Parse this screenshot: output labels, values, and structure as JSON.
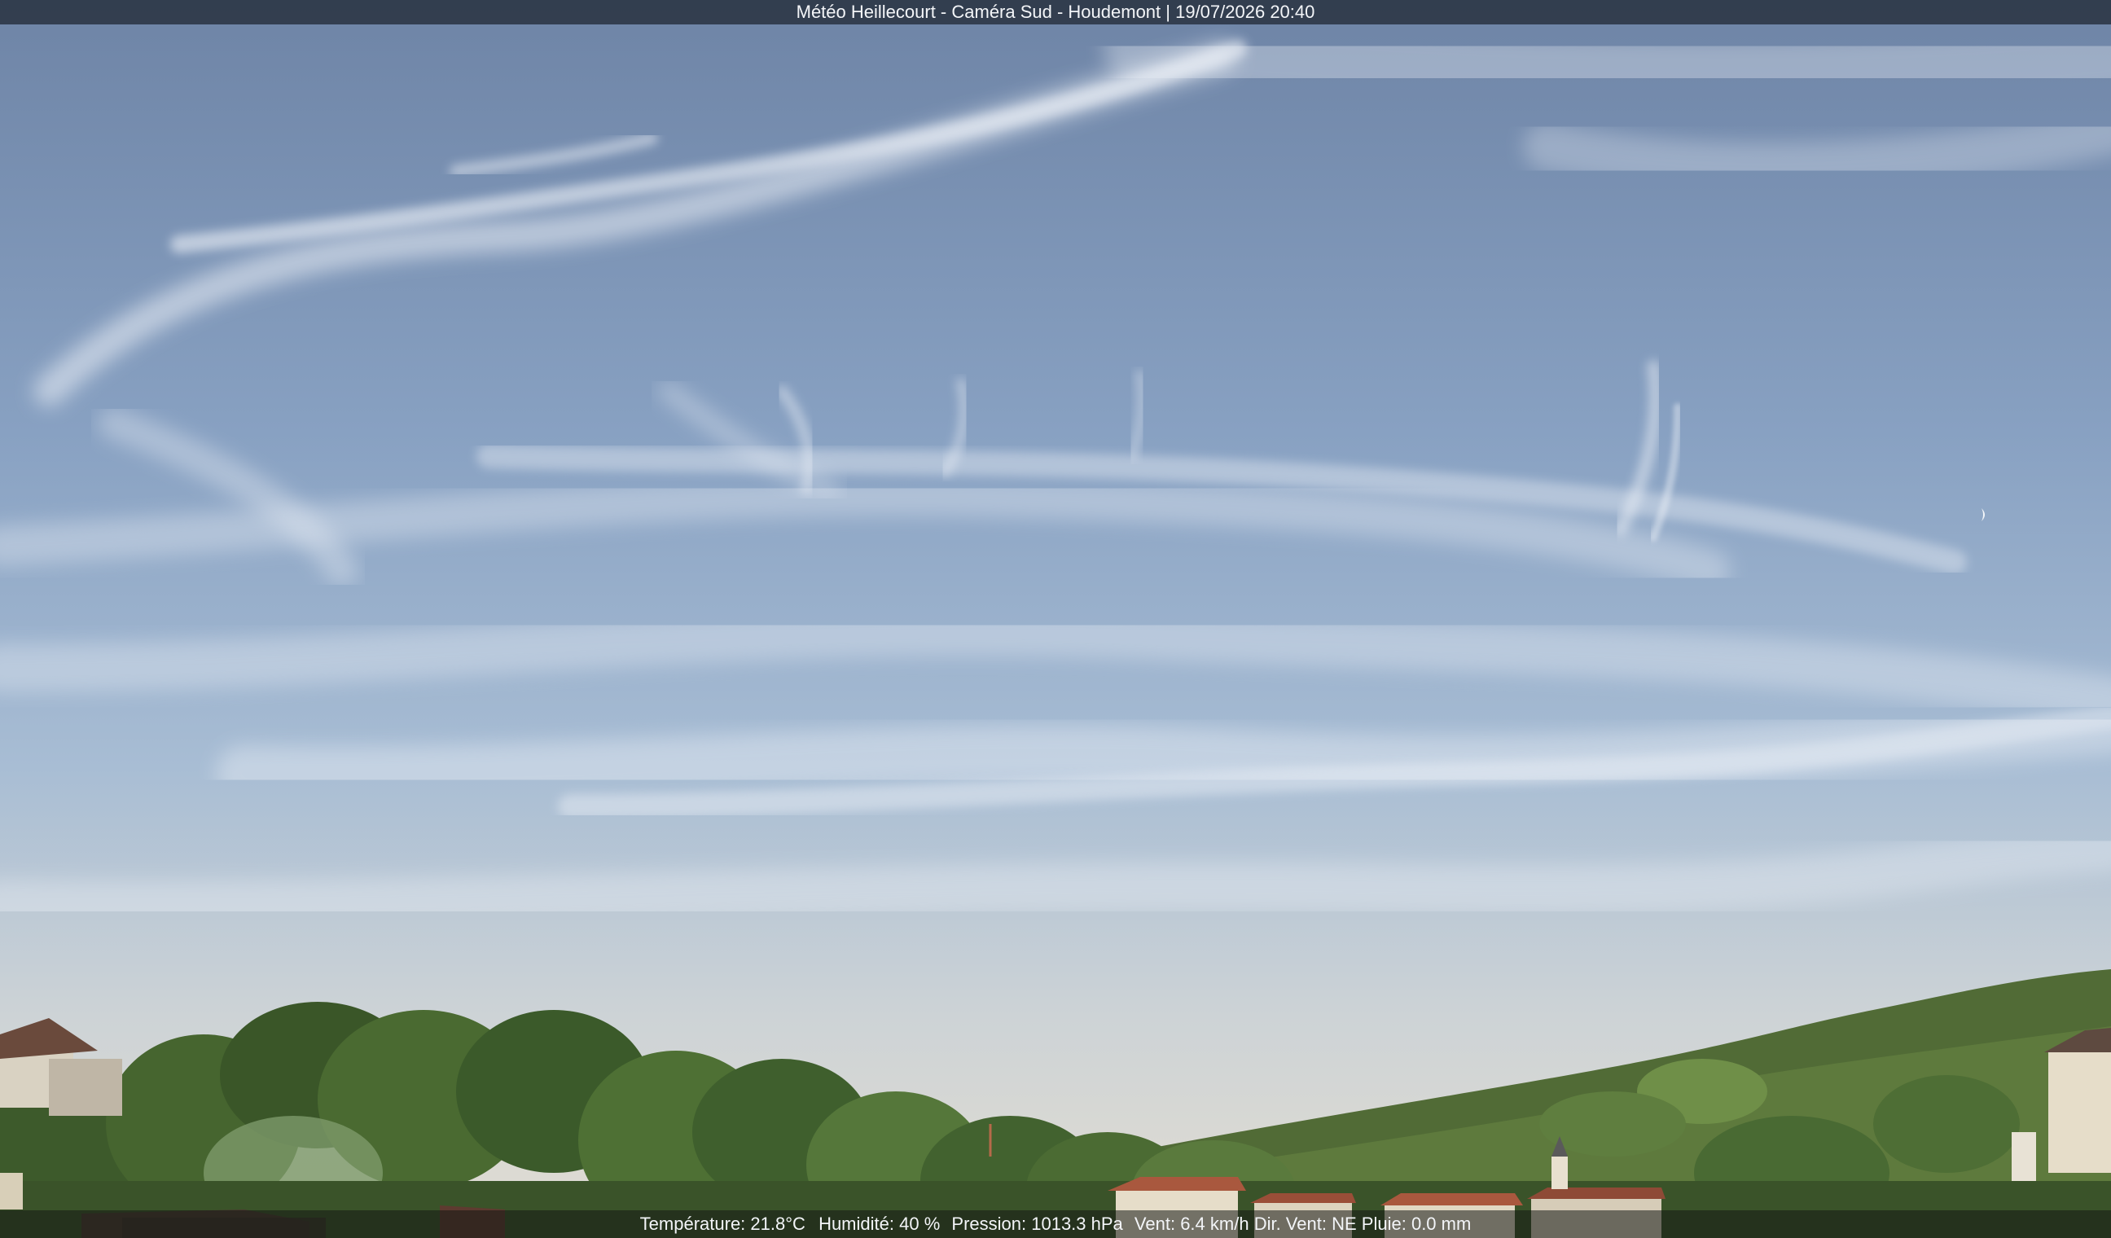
{
  "overlay": {
    "title": "Météo Heillecourt - Caméra Sud - Houdemont | 19/07/2026 20:40",
    "temperature_label": "Température:",
    "temperature_value": "21.8°C",
    "humidity_label": "Humidité:",
    "humidity_value": "40 %",
    "pressure_label": "Pression:",
    "pressure_value": "1013.3 hPa",
    "wind_label": "Vent:",
    "wind_value": "6.4 km/h",
    "wind_dir_label": "Dir. Vent:",
    "wind_dir_value": "NE",
    "rain_label": "Pluie:",
    "rain_value": "0.0 mm"
  },
  "colors": {
    "sky_top": "#6f86a8",
    "sky_mid": "#93abc9",
    "sky_horizon": "#d9d8d2",
    "cloud": "#e8eef6",
    "trees_dark": "#2f4a25",
    "trees_light": "#6f8f48",
    "roof": "#a9583e",
    "wall": "#e6ddc9"
  }
}
